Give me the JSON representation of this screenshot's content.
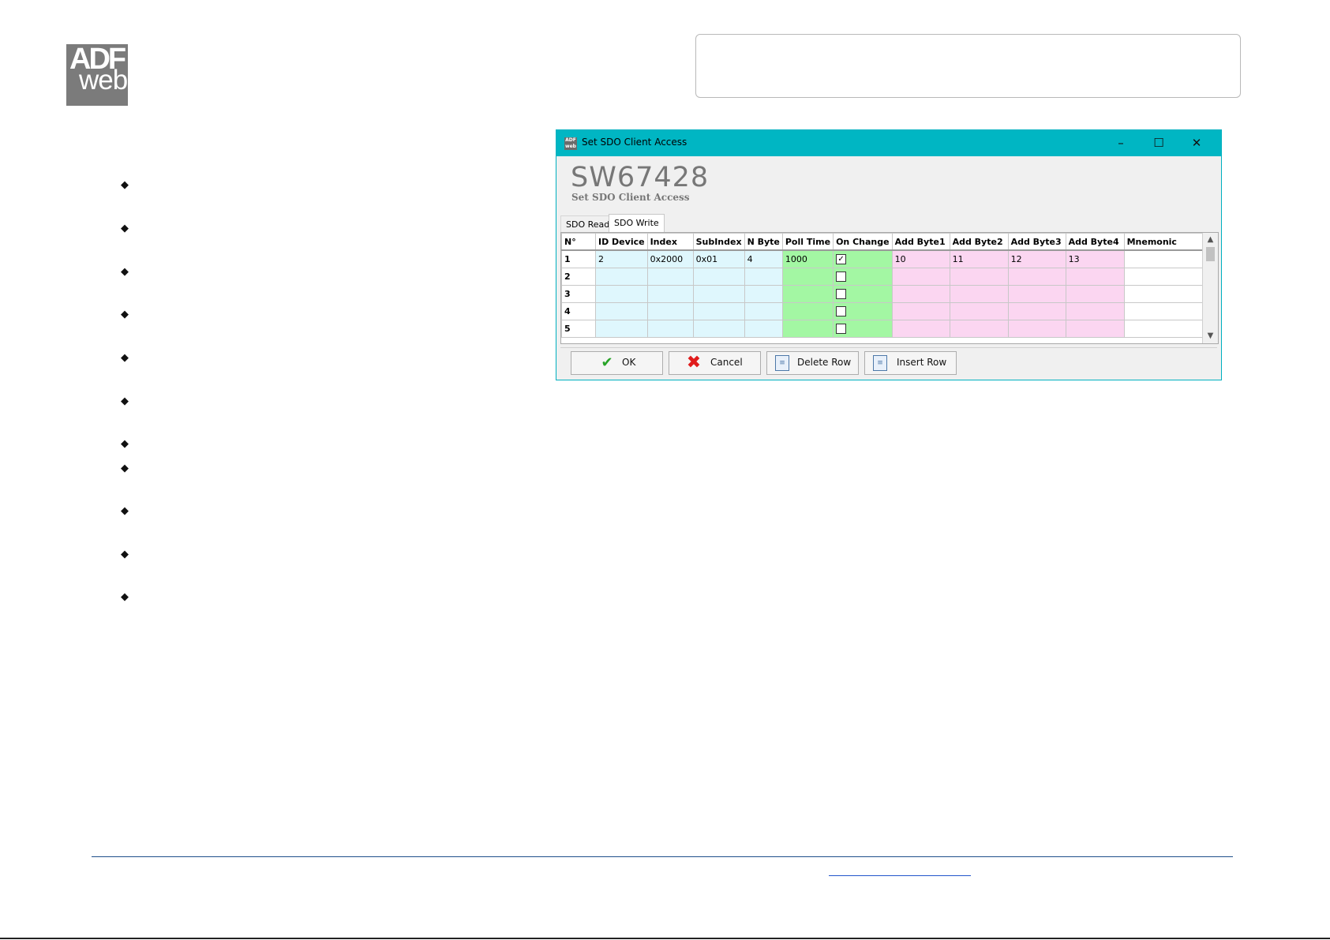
{
  "logo": {
    "line1": "ADF",
    "line2": "web"
  },
  "window": {
    "title": "Set SDO Client Access",
    "heading": "SW67428",
    "subheading": "Set SDO Client Access",
    "controls": {
      "minimize": "–",
      "maximize": "☐",
      "close": "✕"
    }
  },
  "tabs": [
    {
      "label": "SDO Read",
      "active": false
    },
    {
      "label": "SDO Write",
      "active": true
    }
  ],
  "table": {
    "columns": [
      "N°",
      "ID Device",
      "Index",
      "SubIndex",
      "N Byte",
      "Poll Time",
      "On Change",
      "Add Byte1",
      "Add Byte2",
      "Add Byte3",
      "Add Byte4",
      "Mnemonic"
    ],
    "rows": [
      {
        "n": "1",
        "id_device": "2",
        "index": "0x2000",
        "subindex": "0x01",
        "n_byte": "4",
        "poll_time": "1000",
        "on_change": true,
        "add_byte1": "10",
        "add_byte2": "11",
        "add_byte3": "12",
        "add_byte4": "13",
        "mnemonic": ""
      },
      {
        "n": "2",
        "id_device": "",
        "index": "",
        "subindex": "",
        "n_byte": "",
        "poll_time": "",
        "on_change": false,
        "add_byte1": "",
        "add_byte2": "",
        "add_byte3": "",
        "add_byte4": "",
        "mnemonic": ""
      },
      {
        "n": "3",
        "id_device": "",
        "index": "",
        "subindex": "",
        "n_byte": "",
        "poll_time": "",
        "on_change": false,
        "add_byte1": "",
        "add_byte2": "",
        "add_byte3": "",
        "add_byte4": "",
        "mnemonic": ""
      },
      {
        "n": "4",
        "id_device": "",
        "index": "",
        "subindex": "",
        "n_byte": "",
        "poll_time": "",
        "on_change": false,
        "add_byte1": "",
        "add_byte2": "",
        "add_byte3": "",
        "add_byte4": "",
        "mnemonic": ""
      },
      {
        "n": "5",
        "id_device": "",
        "index": "",
        "subindex": "",
        "n_byte": "",
        "poll_time": "",
        "on_change": false,
        "add_byte1": "",
        "add_byte2": "",
        "add_byte3": "",
        "add_byte4": "",
        "mnemonic": ""
      }
    ],
    "colors": {
      "device_cols": "#dff7fd",
      "poll_cols": "#a3f7a3",
      "byte_cols": "#fbd6f1"
    }
  },
  "buttons": {
    "ok": "OK",
    "cancel": "Cancel",
    "delete_row": "Delete Row",
    "insert_row": "Insert Row"
  },
  "icons": {
    "ok": "check-icon",
    "cancel": "cross-icon",
    "delete_row": "delete-row-icon",
    "insert_row": "insert-row-icon",
    "bullet": "diamond-bullet-icon"
  },
  "bullet_count": 11
}
